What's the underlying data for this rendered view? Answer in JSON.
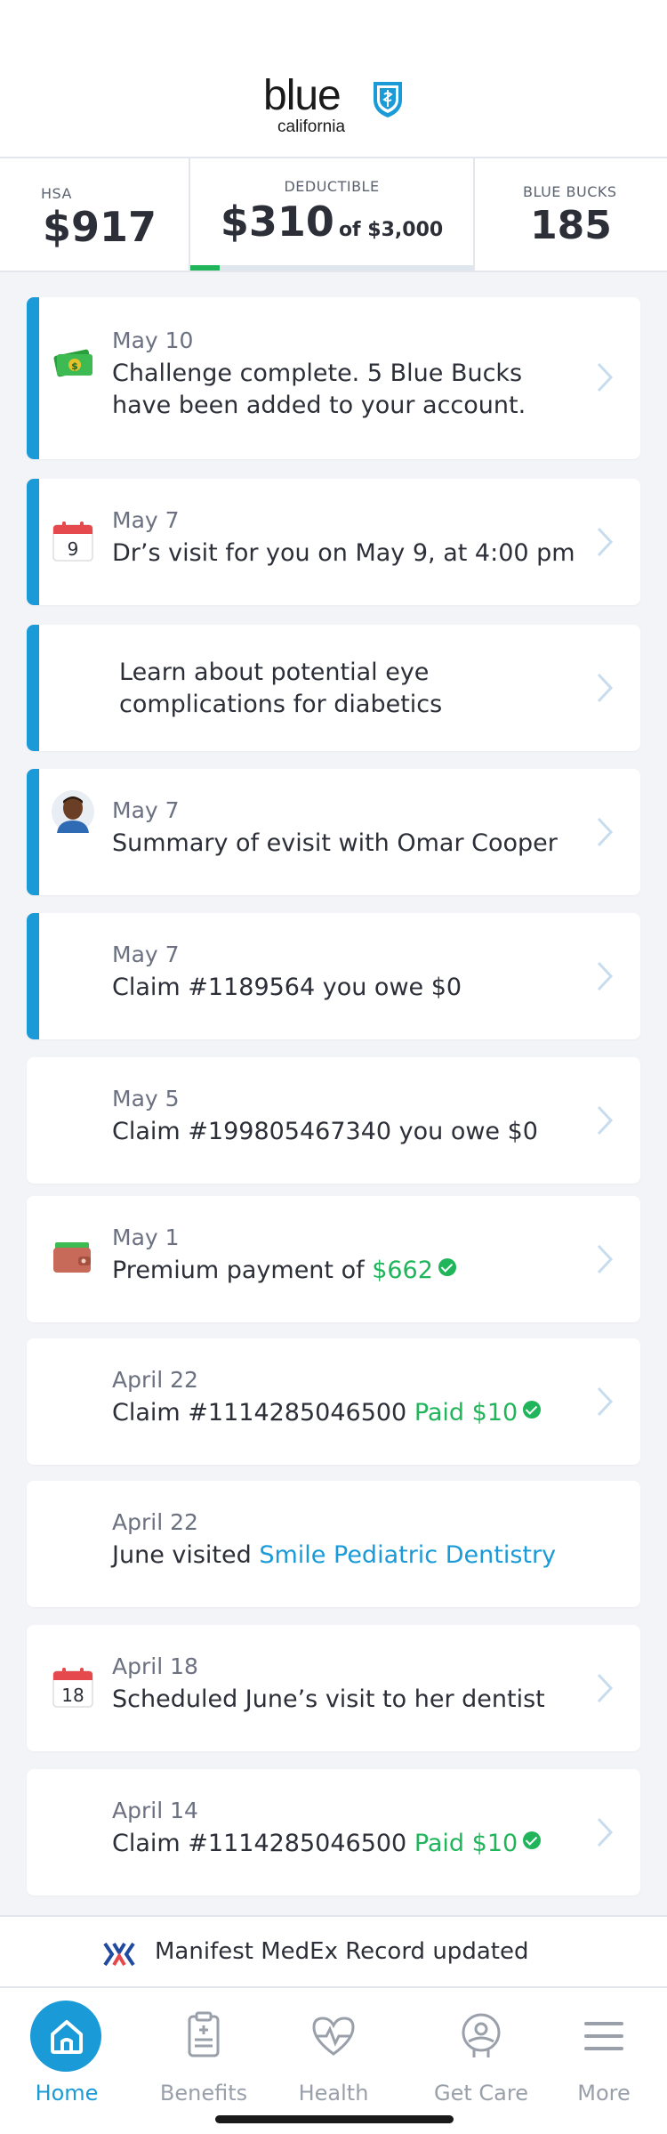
{
  "brand": {
    "name": "blue",
    "sub": "california",
    "color": "#1a9bd7"
  },
  "stats": {
    "hsa": {
      "label": "HSA",
      "value": "$917"
    },
    "deductible": {
      "label": "DEDUCTIBLE",
      "value": "$310",
      "of": "of $3,000",
      "progress": 0.103
    },
    "blue_bucks": {
      "label": "BLUE BUCKS",
      "value": "185"
    }
  },
  "feed": [
    {
      "date": "May 10",
      "title": "Challenge complete. 5 Blue Bucks have been added to your account.",
      "icon": "money-icon"
    },
    {
      "date": "May 7",
      "title": "Dr’s visit for you on May 9, at 4:00 pm",
      "icon": "calendar-icon",
      "icon_day": "9"
    },
    {
      "date": "",
      "title": "Learn about potential eye complications for diabetics",
      "icon": ""
    },
    {
      "date": "May 7",
      "title": "Summary of evisit with Omar Cooper",
      "icon": "avatar"
    },
    {
      "date": "May 7",
      "title": "Claim #1189564 you owe $0",
      "icon": ""
    },
    {
      "date": "May 5",
      "title": "Claim #199805467340 you owe $0",
      "icon": ""
    },
    {
      "date": "May 1",
      "title_prefix": "Premium payment of ",
      "title_highlight": "$662",
      "icon": "wallet-icon"
    },
    {
      "date": "April 22",
      "title_prefix": "Claim #1114285046500 ",
      "title_highlight": "Paid $10",
      "icon": ""
    },
    {
      "date": "April 22",
      "title_prefix": "June visited ",
      "title_link": "Smile Pediatric Dentistry",
      "icon": ""
    },
    {
      "date": "April 18",
      "title": "Scheduled June’s visit to her dentist",
      "icon": "calendar-icon",
      "icon_day": "18"
    },
    {
      "date": "April 14",
      "title_prefix": "Claim #1114285046500 ",
      "title_highlight": "Paid $10",
      "icon": ""
    }
  ],
  "notice": {
    "text": "Manifest MedEx Record updated",
    "icon": "medex-logo-icon"
  },
  "tabs": [
    {
      "label": "Home",
      "icon": "home-icon",
      "active": true
    },
    {
      "label": "Benefits",
      "icon": "clipboard-icon"
    },
    {
      "label": "Health",
      "icon": "heart-pulse-icon"
    },
    {
      "label": "Get Care",
      "icon": "doctor-icon"
    },
    {
      "label": "More",
      "icon": "menu-icon"
    }
  ]
}
